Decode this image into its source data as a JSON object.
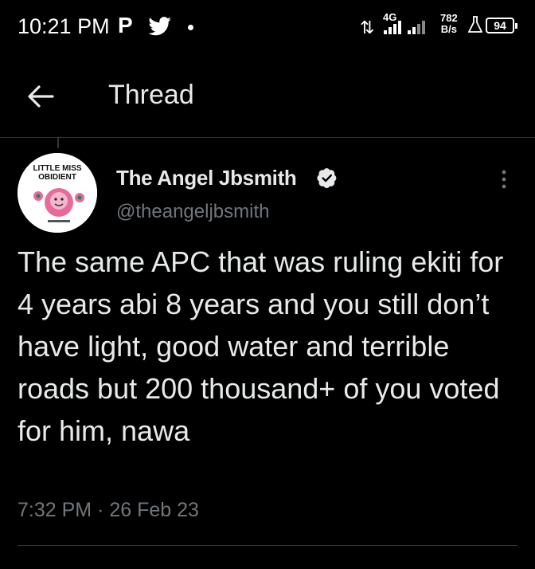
{
  "status_bar": {
    "time": "10:21 PM",
    "network": "4G",
    "speed_value": "782",
    "speed_unit": "B/s",
    "battery": "94"
  },
  "header": {
    "title": "Thread"
  },
  "tweet": {
    "display_name": "The Angel Jbsmith",
    "handle": "@theangeljbsmith",
    "avatar_text_line1": "LITTLE MISS",
    "avatar_text_line2": "OBIDIENT",
    "text": "The same APC that was ruling ekiti for 4 years abi 8 years and you still don’t have light, good water and terrible roads but 200 thousand+ of you voted for him, nawa",
    "timestamp": "7:32 PM · 26 Feb 23"
  },
  "colors": {
    "background": "#000000",
    "text_primary": "#e7e9ea",
    "text_secondary": "#71767b",
    "divider": "#2f3336"
  },
  "icons": {
    "back": "arrow-left-icon",
    "verified": "verified-badge-icon",
    "more": "more-vertical-icon"
  }
}
